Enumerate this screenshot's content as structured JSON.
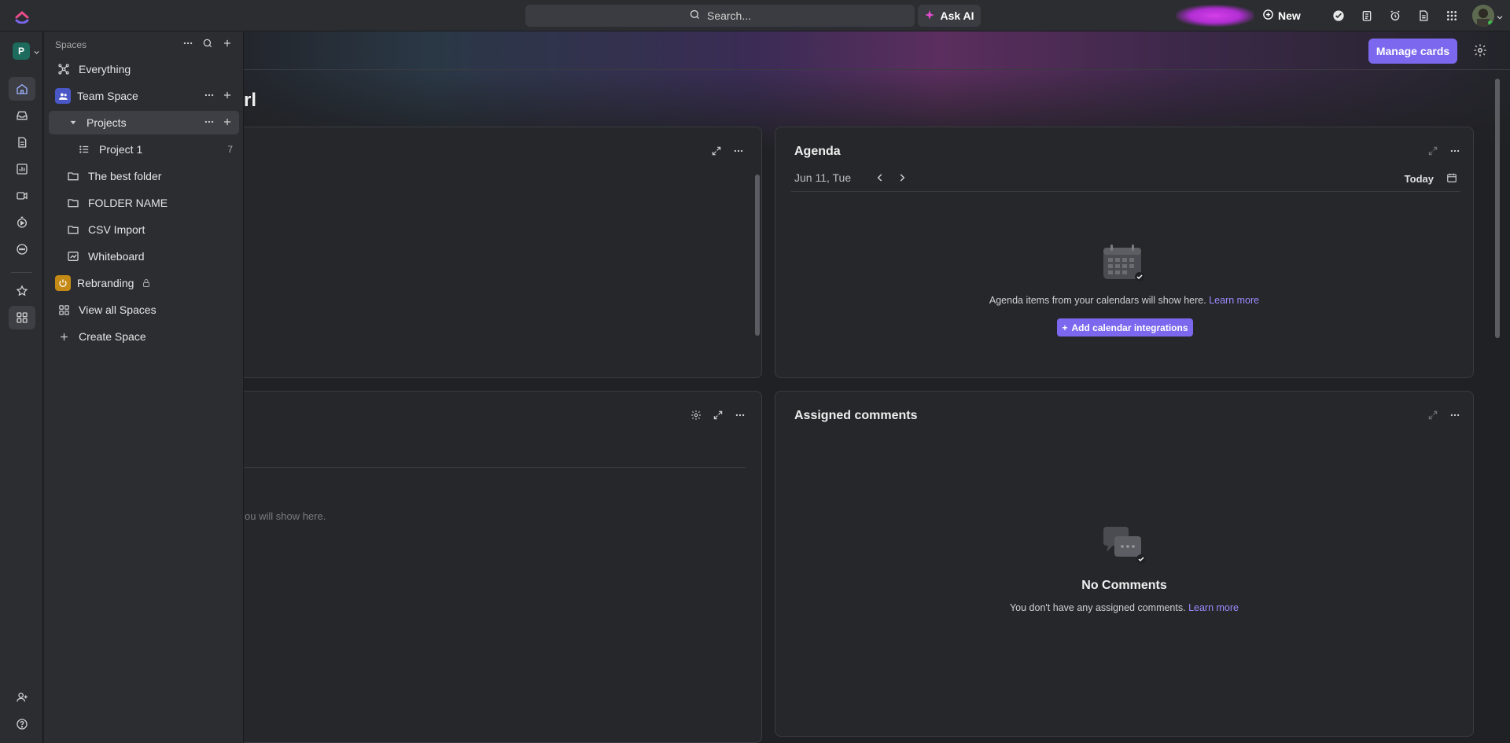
{
  "topbar": {
    "search_placeholder": "Search...",
    "ask_ai_label": "Ask AI",
    "new_label": "New"
  },
  "rail": {
    "workspace_initial": "P"
  },
  "sidebar": {
    "header": "Spaces",
    "items": [
      {
        "label": "Everything"
      },
      {
        "label": "Team Space"
      },
      {
        "label": "Projects"
      },
      {
        "label": "Project 1",
        "count": "7"
      },
      {
        "label": "The best folder"
      },
      {
        "label": "FOLDER NAME"
      },
      {
        "label": "CSV Import"
      },
      {
        "label": "Whiteboard"
      },
      {
        "label": "Rebranding"
      },
      {
        "label": "View all Spaces"
      },
      {
        "label": "Create Space"
      }
    ]
  },
  "header": {
    "manage_cards_label": "Manage cards",
    "greeting_fragment": "rl"
  },
  "cards": {
    "agenda": {
      "title": "Agenda",
      "date": "Jun 11, Tue",
      "today_label": "Today",
      "empty_text": "Agenda items from your calendars will show here.",
      "learn_more": "Learn more",
      "add_button": "Add calendar integrations"
    },
    "left_bottom": {
      "empty_fragment": "ou will show here."
    },
    "assigned_comments": {
      "title": "Assigned comments",
      "empty_title": "No Comments",
      "empty_text": "You don't have any assigned comments.",
      "learn_more": "Learn more"
    }
  },
  "colors": {
    "accent": "#7b68ee",
    "workspace_badge": "#1d6b5d",
    "team_space_icon": "#4a58c7",
    "rebranding_icon": "#c58a16"
  }
}
